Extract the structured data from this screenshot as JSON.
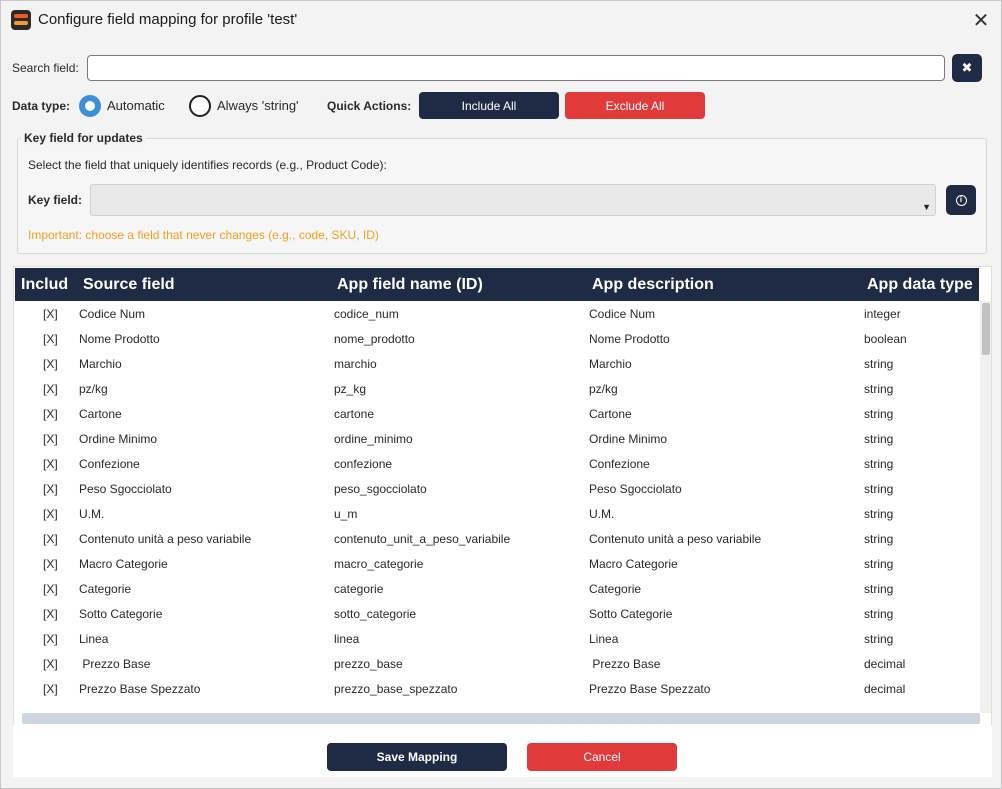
{
  "window": {
    "title": "Configure field mapping for profile 'test'"
  },
  "search": {
    "label": "Search field:",
    "value": "",
    "placeholder": "",
    "clear_icon": "✖"
  },
  "data_type": {
    "label": "Data type:",
    "options": [
      {
        "label": "Automatic",
        "selected": true
      },
      {
        "label": "Always 'string'",
        "selected": false
      }
    ]
  },
  "quick_actions": {
    "label": "Quick Actions:",
    "include_all": "Include All",
    "exclude_all": "Exclude All"
  },
  "key_field": {
    "group_title": "Key field for updates",
    "description": "Select the field that uniquely identifies records (e.g., Product Code):",
    "label": "Key field:",
    "value": "",
    "info_icon": "i",
    "warning": "Important: choose a field that never changes (e.g., code, SKU, ID)"
  },
  "table": {
    "columns": [
      "Includ",
      "Source field",
      "App field name (ID)",
      "App description",
      "App data type"
    ],
    "rows": [
      [
        "[X]",
        "Codice Num",
        "codice_num",
        "Codice Num",
        "integer"
      ],
      [
        "[X]",
        "Nome Prodotto",
        "nome_prodotto",
        "Nome Prodotto",
        "boolean"
      ],
      [
        "[X]",
        "Marchio",
        "marchio",
        "Marchio",
        "string"
      ],
      [
        "[X]",
        "pz/kg",
        "pz_kg",
        "pz/kg",
        "string"
      ],
      [
        "[X]",
        "Cartone",
        "cartone",
        "Cartone",
        "string"
      ],
      [
        "[X]",
        "Ordine Minimo",
        "ordine_minimo",
        "Ordine Minimo",
        "string"
      ],
      [
        "[X]",
        "Confezione",
        "confezione",
        "Confezione",
        "string"
      ],
      [
        "[X]",
        "Peso Sgocciolato",
        "peso_sgocciolato",
        "Peso Sgocciolato",
        "string"
      ],
      [
        "[X]",
        "U.M.",
        "u_m",
        "U.M.",
        "string"
      ],
      [
        "[X]",
        "Contenuto unità a peso variabile",
        "contenuto_unit_a_peso_variabile",
        "Contenuto unità a peso variabile",
        "string"
      ],
      [
        "[X]",
        "Macro Categorie",
        "macro_categorie",
        "Macro Categorie",
        "string"
      ],
      [
        "[X]",
        "Categorie",
        "categorie",
        "Categorie",
        "string"
      ],
      [
        "[X]",
        "Sotto Categorie",
        "sotto_categorie",
        "Sotto Categorie",
        "string"
      ],
      [
        "[X]",
        "Linea",
        "linea",
        "Linea",
        "string"
      ],
      [
        "[X]",
        " Prezzo Base",
        "prezzo_base",
        " Prezzo Base",
        "decimal"
      ],
      [
        "[X]",
        "Prezzo Base Spezzato",
        "prezzo_base_spezzato",
        "Prezzo Base Spezzato",
        "decimal"
      ]
    ]
  },
  "footer": {
    "save": "Save Mapping",
    "cancel": "Cancel"
  },
  "colors": {
    "dark": "#1f2a44",
    "red": "#e03a3a",
    "accent": "#3a8fd8",
    "warning": "#f0a020"
  }
}
